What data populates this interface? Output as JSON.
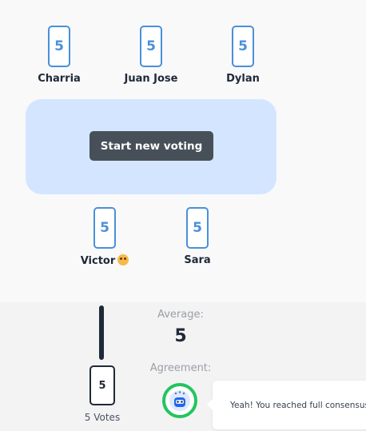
{
  "players_top": [
    {
      "name": "Charria",
      "vote": "5"
    },
    {
      "name": "Juan Jose",
      "vote": "5"
    },
    {
      "name": "Dylan",
      "vote": "5"
    }
  ],
  "table": {
    "start_button": "Start new voting"
  },
  "players_bottom": [
    {
      "name": "Victor",
      "vote": "5",
      "emoji_icon": "smiling-face-icon"
    },
    {
      "name": "Sara",
      "vote": "5"
    }
  ],
  "results": {
    "distribution": [
      {
        "card": "5",
        "votes_label": "5 Votes"
      }
    ],
    "average_label": "Average:",
    "average_value": "5",
    "agreement_label": "Agreement:",
    "agreement_icon": "robot-icon",
    "agreement_message": "Yeah! You reached full consensus."
  },
  "colors": {
    "card_accent": "#4a90d9",
    "table_bg": "#d4e6ff",
    "button_bg": "#475058",
    "agreement_ring": "#22c55e"
  }
}
